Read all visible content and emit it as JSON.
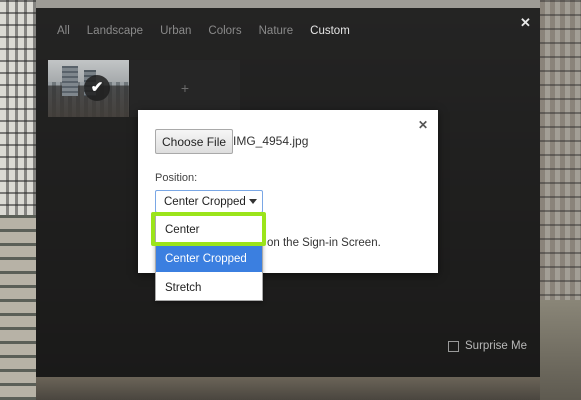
{
  "tabs": [
    "All",
    "Landscape",
    "Urban",
    "Colors",
    "Nature",
    "Custom"
  ],
  "active_tab": "Custom",
  "close_glyph": "✕",
  "selected_check_glyph": "✔",
  "add_tile_glyph": "+",
  "surprise": {
    "label": "Surprise Me",
    "checked": false
  },
  "dialog": {
    "close_glyph": "✕",
    "choose_button": "Choose File",
    "filename": "IMG_4954.jpg",
    "position_label": "Position:",
    "selected_position": "Center Cropped",
    "note": "on the Sign-in Screen."
  },
  "dropdown": {
    "options": [
      "Center",
      "Center Cropped",
      "Stretch"
    ],
    "highlighted": "Center Cropped"
  },
  "colors": {
    "highlight_box": "#9be41a",
    "selected_option": "#3b7fe0",
    "panel": "#141414"
  },
  "icons": {
    "close": "close-icon",
    "check": "checkmark-icon",
    "add": "plus-icon",
    "caret": "caret-down-icon"
  }
}
